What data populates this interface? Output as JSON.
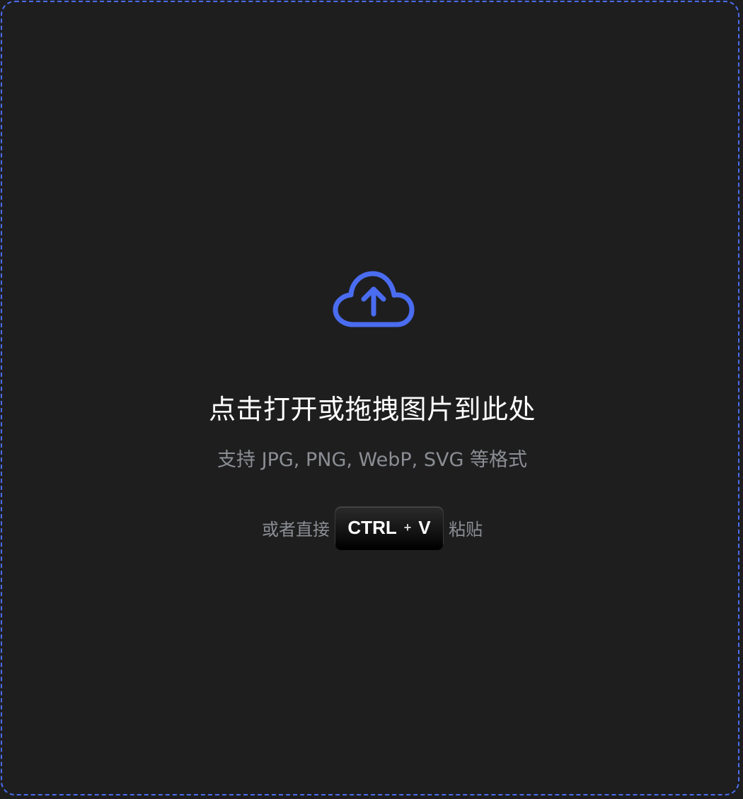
{
  "dropzone": {
    "title": "点击打开或拖拽图片到此处",
    "subtitle": "支持 JPG, PNG, WebP, SVG 等格式",
    "paste": {
      "before": "或者直接",
      "key_ctrl": "CTRL",
      "key_plus": "+",
      "key_v": "V",
      "after": "粘贴"
    },
    "icon": "cloud-upload-icon",
    "accent_color": "#4a6cf0"
  }
}
